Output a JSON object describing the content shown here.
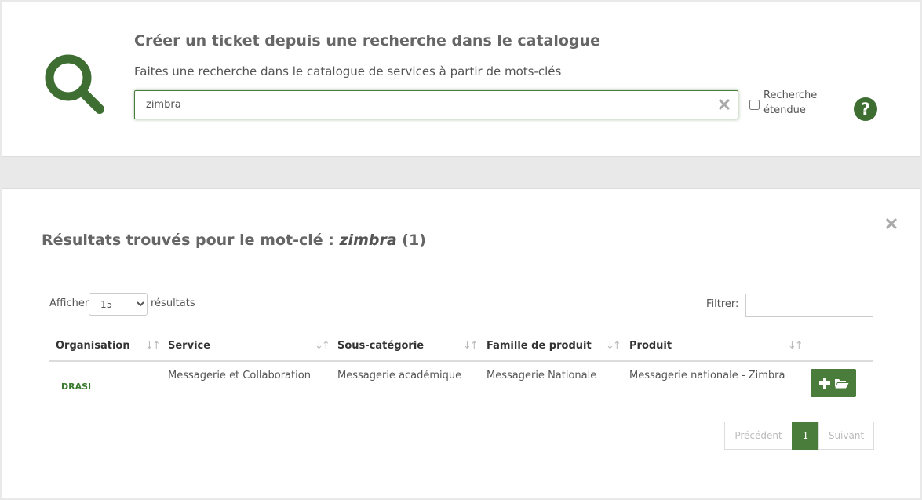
{
  "header": {
    "title": "Créer un ticket depuis une recherche dans le catalogue",
    "subtitle": "Faites une recherche dans le catalogue de services à partir de mots-clés"
  },
  "search": {
    "value": "zimbra",
    "extended_label": "Recherche étendue",
    "extended_checked": false
  },
  "icons": {
    "search": "search-icon",
    "clear": "close-icon",
    "help": "question-circle-icon",
    "close_results": "close-icon",
    "add": "plus-icon",
    "folder": "folder-open-icon",
    "sort": "sort-icon"
  },
  "colors": {
    "accent": "#4a7c3c",
    "org_link": "#3a7a2e",
    "title": "#666666"
  },
  "results": {
    "title_prefix": "Résultats trouvés pour le mot-clé :",
    "keyword": "zimbra",
    "count": "(1)",
    "show_label": "Afficher",
    "page_size": "15",
    "page_size_suffix": "résultats",
    "filter_label": "Filtrer:",
    "filter_value": "",
    "columns": [
      "Organisation",
      "Service",
      "Sous-catégorie",
      "Famille de produit",
      "Produit"
    ],
    "rows": [
      {
        "organisation": "DRASI",
        "service": "Messagerie et Collaboration",
        "sous_categorie": "Messagerie académique",
        "famille": "Messagerie Nationale",
        "produit": "Messagerie nationale - Zimbra"
      }
    ],
    "pagination": {
      "prev": "Précédent",
      "current": "1",
      "next": "Suivant"
    }
  }
}
